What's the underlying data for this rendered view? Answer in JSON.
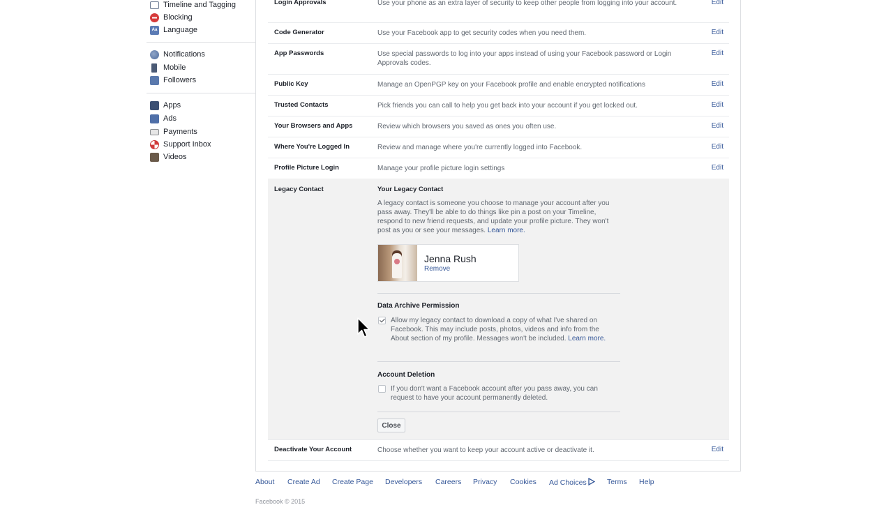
{
  "sidebar": {
    "group1": [
      {
        "label": "Timeline and Tagging",
        "icon": "timeline-icon"
      },
      {
        "label": "Blocking",
        "icon": "blocking-icon"
      },
      {
        "label": "Language",
        "icon": "language-icon"
      }
    ],
    "group2": [
      {
        "label": "Notifications",
        "icon": "globe-icon"
      },
      {
        "label": "Mobile",
        "icon": "mobile-icon"
      },
      {
        "label": "Followers",
        "icon": "followers-icon"
      }
    ],
    "group3": [
      {
        "label": "Apps",
        "icon": "apps-icon"
      },
      {
        "label": "Ads",
        "icon": "ads-icon"
      },
      {
        "label": "Payments",
        "icon": "payments-icon"
      },
      {
        "label": "Support Inbox",
        "icon": "support-icon"
      },
      {
        "label": "Videos",
        "icon": "videos-icon"
      }
    ]
  },
  "settings": {
    "edit_label": "Edit",
    "rows": [
      {
        "label": "Login Approvals",
        "desc": "Use your phone as an extra layer of security to keep other people from logging into your account."
      },
      {
        "label": "Code Generator",
        "desc": "Use your Facebook app to get security codes when you need them."
      },
      {
        "label": "App Passwords",
        "desc": "Use special passwords to log into your apps instead of using your Facebook password or Login Approvals codes."
      },
      {
        "label": "Public Key",
        "desc": "Manage an OpenPGP key on your Facebook profile and enable encrypted notifications"
      },
      {
        "label": "Trusted Contacts",
        "desc": "Pick friends you can call to help you get back into your account if you get locked out."
      },
      {
        "label": "Your Browsers and Apps",
        "desc": "Review which browsers you saved as ones you often use."
      },
      {
        "label": "Where You're Logged In",
        "desc": "Review and manage where you're currently logged into Facebook."
      },
      {
        "label": "Profile Picture Login",
        "desc": "Manage your profile picture login settings"
      }
    ],
    "deactivate": {
      "label": "Deactivate Your Account",
      "desc": "Choose whether you want to keep your account active or deactivate it."
    }
  },
  "legacy": {
    "label": "Legacy Contact",
    "title": "Your Legacy Contact",
    "desc": "A legacy contact is someone you choose to manage your account after you pass away. They'll be able to do things like pin a post on your Timeline, respond to new friend requests, and update your profile picture. They won't post as you or see your messages.",
    "learn_more": "Learn more.",
    "contact_name": "Jenna Rush",
    "remove_label": "Remove",
    "archive_title": "Data Archive Permission",
    "archive_text": "Allow my legacy contact to download a copy of what I've shared on Facebook. This may include posts, photos, videos and info from the About section of my profile. Messages won't be included.",
    "archive_learn_1": "Learn",
    "archive_learn_2": "more.",
    "archive_checked": true,
    "deletion_title": "Account Deletion",
    "deletion_text": "If you don't want a Facebook account after you pass away, you can request to have your account permanently deleted.",
    "deletion_checked": false,
    "close_label": "Close"
  },
  "footer": {
    "links": [
      "About",
      "Create Ad",
      "Create Page",
      "Developers",
      "Careers",
      "Privacy",
      "Cookies",
      "Ad Choices",
      "Terms",
      "Help"
    ],
    "copyright": "Facebook © 2015"
  }
}
